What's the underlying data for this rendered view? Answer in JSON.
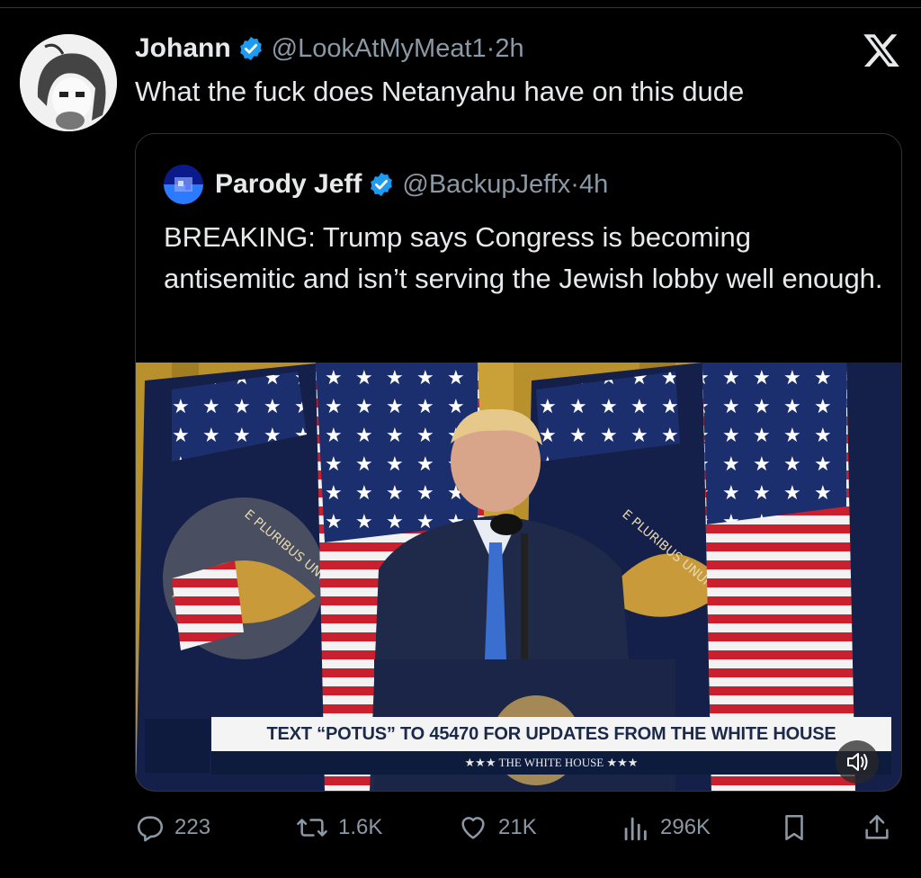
{
  "post": {
    "author_name": "Johann",
    "author_handle": "@LookAtMyMeat1",
    "time": "2h",
    "text": "What the fuck does Netanyahu have on this dude"
  },
  "quoted": {
    "author_name": "Parody Jeff",
    "author_handle": "@BackupJeffx",
    "time": "4h",
    "text": "BREAKING: Trump says Congress is becoming antisemitic and isn’t serving the Jewish lobby well enough.",
    "media": {
      "seal_text": "E PLURIBUS UNUM",
      "ticker_text": "TEXT “POTUS” TO 45470 FOR UPDATES FROM THE WHITE HOUSE",
      "ticker_subtext": "★★★  THE WHITE HOUSE  ★★★"
    }
  },
  "actions": {
    "replies": "223",
    "reposts": "1.6K",
    "likes": "21K",
    "views": "296K"
  },
  "colors": {
    "background": "#000000",
    "text": "#e7e9ea",
    "secondary": "#8b98a5",
    "verified": "#1d9bf0",
    "border": "#2f3336"
  },
  "icons": [
    "verified-badge-icon",
    "x-logo-icon",
    "reply-icon",
    "repost-icon",
    "like-icon",
    "views-icon",
    "bookmark-icon",
    "share-icon",
    "sound-icon"
  ]
}
